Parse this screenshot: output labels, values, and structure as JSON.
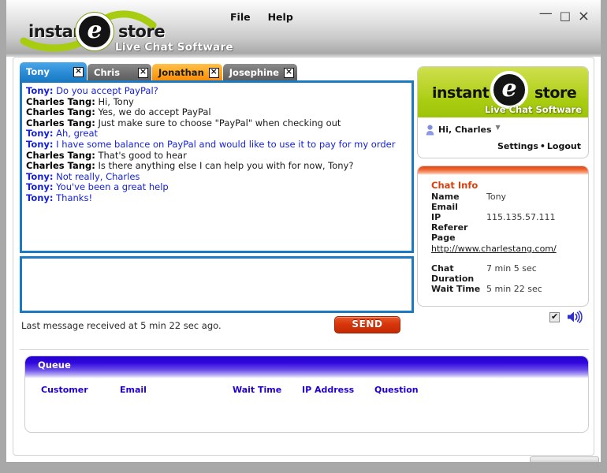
{
  "window": {
    "minimize_label": "—",
    "maximize_label": "□",
    "close_label": "×"
  },
  "header": {
    "brand_part1": "instant",
    "brand_letter": "e",
    "brand_part2": "store",
    "tagline": "Live Chat Software",
    "menu": [
      {
        "label": "File"
      },
      {
        "label": "Help"
      }
    ]
  },
  "tabs": [
    {
      "label": "Tony",
      "state": "active",
      "close_label": "×"
    },
    {
      "label": "Chris",
      "state": "idle",
      "close_label": "×"
    },
    {
      "label": "Jonathan",
      "state": "alert",
      "close_label": "×"
    },
    {
      "label": "Josephine",
      "state": "idle",
      "close_label": "×"
    }
  ],
  "transcript": [
    {
      "who": "Tony:",
      "text": "Do you accept PayPal?",
      "role": "visitor"
    },
    {
      "who": "Charles Tang:",
      "text": "Hi, Tony",
      "role": "agent"
    },
    {
      "who": "Charles Tang:",
      "text": "Yes, we do accept PayPal",
      "role": "agent"
    },
    {
      "who": "Charles Tang:",
      "text": "Just make sure to choose \"PayPal\" when checking out",
      "role": "agent"
    },
    {
      "who": "Tony:",
      "text": "Ah, great",
      "role": "visitor"
    },
    {
      "who": "Tony:",
      "text": "I have some balance on PayPal and would like to use it to pay for my order",
      "role": "visitor"
    },
    {
      "who": "Charles Tang:",
      "text": "That's good to hear",
      "role": "agent"
    },
    {
      "who": "Charles Tang:",
      "text": "Is there anything else I can help you with for now, Tony?",
      "role": "agent"
    },
    {
      "who": "Tony:",
      "text": "Not really, Charles",
      "role": "visitor"
    },
    {
      "who": "Tony:",
      "text": "You've been a great help",
      "role": "visitor"
    },
    {
      "who": "Tony:",
      "text": "Thanks!",
      "role": "visitor"
    }
  ],
  "compose": {
    "value": "",
    "placeholder": ""
  },
  "status": {
    "last_message_text": "Last message received at 5 min 22 sec ago.",
    "send_label": "SEND"
  },
  "brand_card": {
    "brand_part1": "instant",
    "brand_letter": "e",
    "brand_part2": "store",
    "tagline": "Live Chat Software",
    "greeting": "Hi, Charles",
    "caret": "▼",
    "settings_label": "Settings",
    "separator": "•",
    "logout_label": "Logout"
  },
  "chat_info": {
    "title": "Chat Info",
    "name_key": "Name",
    "name_value": "Tony",
    "email_key": "Email",
    "email_value": "",
    "ip_key": "IP",
    "ip_value": "115.135.57.111",
    "referer_key": "Referer Page",
    "referer_value": "http://www.charlestang.com/",
    "duration_key_line1": "Chat",
    "duration_key_line2": "Duration",
    "duration_value": "7 min 5 sec",
    "wait_key": "Wait Time",
    "wait_value": "5 min 22 sec"
  },
  "audio": {
    "sound_enabled": true,
    "checkbox_label": "✔",
    "speaker_icon_name": "speaker-on-icon"
  },
  "queue": {
    "title": "Queue",
    "columns": [
      {
        "label": "Customer"
      },
      {
        "label": "Email"
      },
      {
        "label": "Wait Time"
      },
      {
        "label": "IP Address"
      },
      {
        "label": "Question"
      }
    ],
    "rows": []
  },
  "colors": {
    "accent_blue": "#1a7ac4",
    "visitor_text": "#1622d8",
    "tab_alert": "#ffa41f",
    "send_red": "#d8360b",
    "chatinfo_orange": "#d8400c",
    "queue_blue": "#2200cc",
    "brand_green": "#a8cc10"
  }
}
